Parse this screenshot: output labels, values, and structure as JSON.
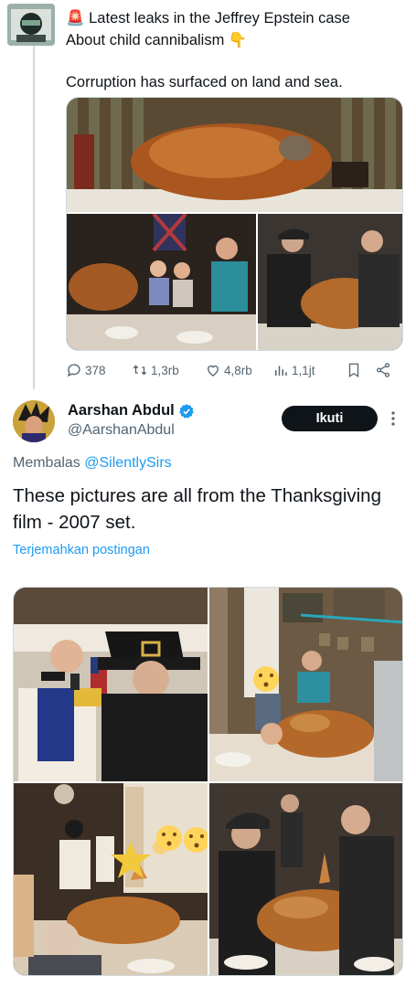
{
  "parent_tweet": {
    "line1": "🚨 Latest leaks in the Jeffrey Epstein case",
    "line2": "About child cannibalism 👇",
    "line3": "Corruption has surfaced on land and sea.",
    "stats": {
      "replies": "378",
      "reposts": "1,3rb",
      "likes": "4,8rb",
      "views": "1,1jt"
    }
  },
  "reply_tweet": {
    "display_name": "Aarshan Abdul",
    "handle": "@AarshanAbdul",
    "follow_label": "Ikuti",
    "replying_prefix": "Membalas",
    "replying_to": "@SilentlySirs",
    "text": "These pictures are all from the Thanksgiving film - 2007 set.",
    "translate_label": "Terjemahkan postingan"
  },
  "icons": {
    "verified": "verified-badge-icon",
    "reply": "reply-icon",
    "repost": "repost-icon",
    "like": "heart-icon",
    "views": "views-icon",
    "bookmark": "bookmark-icon",
    "share": "share-icon",
    "more": "more-dots-icon"
  },
  "colors": {
    "accent": "#1d9bf0",
    "text": "#0f1419",
    "secondary": "#536471",
    "follow_bg": "#0f1419"
  }
}
